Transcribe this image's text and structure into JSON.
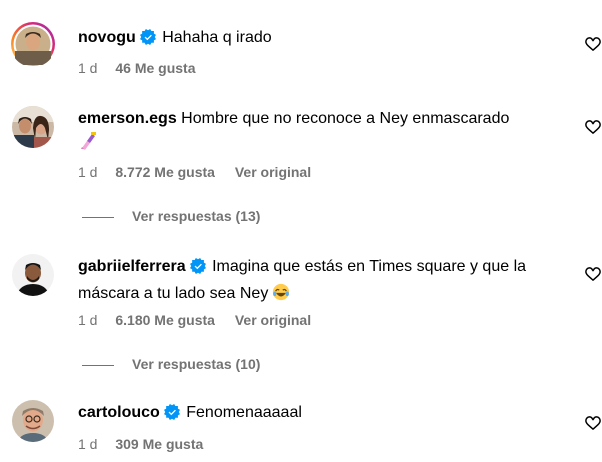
{
  "comments": [
    {
      "username": "novogu",
      "verified": true,
      "text": "Hahaha q irado",
      "time": "1 d",
      "likes": "46 Me gusta",
      "translate": ""
    },
    {
      "username": "emerson.egs",
      "verified": false,
      "text": "Hombre que no reconoce a Ney enmascarado",
      "emoji": "💅",
      "time": "1 d",
      "likes": "8.772 Me gusta",
      "translate": "Ver original",
      "replies": "Ver respuestas (13)"
    },
    {
      "username": "gabriielferrera",
      "verified": true,
      "text": "Imagina que estás en Times square y que la máscara a tu lado sea Ney",
      "emoji": "😂",
      "time": "1 d",
      "likes": "6.180 Me gusta",
      "translate": "Ver original",
      "replies": "Ver respuestas (10)"
    },
    {
      "username": "cartolouco",
      "verified": true,
      "text": "Fenomenaaaaal",
      "time": "1 d",
      "likes": "309 Me gusta",
      "translate": ""
    }
  ],
  "colors": {
    "verified_blue": "#0095F6",
    "meta_gray": "#737373",
    "story_ring": [
      "#FEDA75",
      "#FA7E1E",
      "#D62976",
      "#962FBF"
    ]
  },
  "icons": [
    "verified-badge-icon",
    "heart-outline-icon",
    "nail-polish-emoji",
    "laughing-emoji"
  ]
}
